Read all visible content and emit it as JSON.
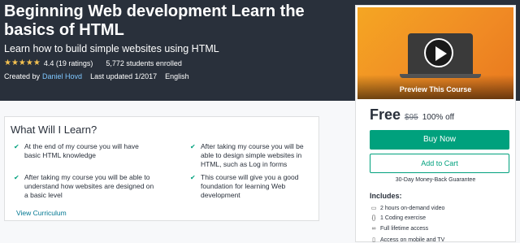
{
  "course": {
    "title": "Beginning Web development Learn the basics of HTML",
    "subtitle": "Learn how to build simple websites using HTML",
    "stars": "★★★★★",
    "rating": "4.4 (19 ratings)",
    "enrolled": "5,772 students enrolled",
    "created_by_label": "Created by",
    "author": "Daniel Hovd",
    "updated": "Last updated 1/2017",
    "language": "English"
  },
  "sidebar": {
    "preview_label": "Preview This Course",
    "price": "Free",
    "old_price": "$95",
    "discount": "100% off",
    "buy_label": "Buy Now",
    "cart_label": "Add to Cart",
    "guarantee": "30-Day Money-Back Guarantee",
    "includes_title": "Includes:",
    "includes": [
      {
        "icon": "video-icon",
        "text": "2 hours on-demand video"
      },
      {
        "icon": "code-icon",
        "text": "1 Coding exercise"
      },
      {
        "icon": "infinity-icon",
        "text": "Full lifetime access"
      },
      {
        "icon": "mobile-icon",
        "text": "Access on mobile and TV"
      }
    ]
  },
  "learn": {
    "title": "What Will I Learn?",
    "items": [
      "At the end of my course you will have basic HTML knowledge",
      "After taking my course you will be able to design simple websites in HTML, such as Log in forms",
      "After taking my course you will be able to understand how websites are designed on a basic level",
      "This course will give you a good foundation for learning Web development"
    ],
    "view_link": "View Curriculum"
  },
  "colors": {
    "hero_bg": "#29303b",
    "accent_green": "#00a17d",
    "star": "#f4c150",
    "link": "#007791"
  }
}
